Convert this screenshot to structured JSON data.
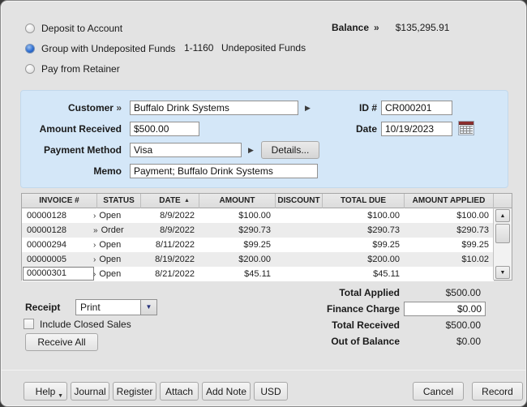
{
  "colors": {
    "panel_blue": "#d4e7f8",
    "window_background": "#e3e3e3",
    "radio_selected_blue": "#2f6fd2",
    "combo_arrow_blue": "#24307a",
    "calendar_icon_red": "#8c2f2f"
  },
  "icons": {
    "picker_arrow": "▶",
    "sort_ascending": "▲",
    "scroll_up": "▲",
    "scroll_down": "▼",
    "combo_arrow": "▼",
    "help_menu_arrow": "▼"
  },
  "deposit_options": {
    "radios": [
      {
        "label": "Deposit to Account",
        "selected": false
      },
      {
        "label": "Group with Undeposited Funds",
        "selected": true
      },
      {
        "label": "Pay from Retainer",
        "selected": false
      }
    ],
    "account_number": "1-1160",
    "account_name": "Undeposited Funds"
  },
  "balance": {
    "label": "Balance",
    "chevron": "»",
    "value": "$135,295.91"
  },
  "payment_form": {
    "customer_label": "Customer",
    "customer_chevron": "»",
    "customer_value": "Buffalo Drink Systems",
    "id_label": "ID #",
    "id_value": "CR000201",
    "amount_received_label": "Amount Received",
    "amount_received_value": "$500.00",
    "date_label": "Date",
    "date_value": "10/19/2023",
    "payment_method_label": "Payment Method",
    "payment_method_value": "Visa",
    "details_button": "Details...",
    "memo_label": "Memo",
    "memo_value": "Payment; Buffalo Drink Systems"
  },
  "invoice_table": {
    "columns": [
      "INVOICE #",
      "STATUS",
      "DATE",
      "AMOUNT",
      "DISCOUNT",
      "TOTAL DUE",
      "AMOUNT APPLIED"
    ],
    "sort_column": "DATE",
    "sort_direction": "ascending",
    "rows": [
      {
        "invoice": "00000128",
        "arrow": "›",
        "status": "Open",
        "date": "8/9/2022",
        "amount": "$100.00",
        "discount": "",
        "total_due": "$100.00",
        "amount_applied": "$100.00"
      },
      {
        "invoice": "00000128",
        "arrow": "»",
        "status": "Order",
        "date": "8/9/2022",
        "amount": "$290.73",
        "discount": "",
        "total_due": "$290.73",
        "amount_applied": "$290.73"
      },
      {
        "invoice": "00000294",
        "arrow": "›",
        "status": "Open",
        "date": "8/11/2022",
        "amount": "$99.25",
        "discount": "",
        "total_due": "$99.25",
        "amount_applied": "$99.25"
      },
      {
        "invoice": "00000005",
        "arrow": "›",
        "status": "Open",
        "date": "8/19/2022",
        "amount": "$200.00",
        "discount": "",
        "total_due": "$200.00",
        "amount_applied": "$10.02"
      },
      {
        "invoice": "00000301",
        "arrow": "›",
        "status": "Open",
        "date": "8/21/2022",
        "amount": "$45.11",
        "discount": "",
        "total_due": "$45.11",
        "amount_applied": ""
      }
    ]
  },
  "totals": {
    "total_applied": {
      "label": "Total Applied",
      "value": "$500.00"
    },
    "finance_charge": {
      "label": "Finance Charge",
      "value": "$0.00"
    },
    "total_received": {
      "label": "Total Received",
      "value": "$500.00"
    },
    "out_of_balance": {
      "label": "Out of Balance",
      "value": "$0.00"
    }
  },
  "receipt": {
    "label": "Receipt",
    "selected_option": "Print"
  },
  "include_closed_sales": {
    "label": "Include Closed Sales",
    "checked": false
  },
  "receive_all_button": "Receive All",
  "footer": {
    "buttons": [
      "Help",
      "Journal",
      "Register",
      "Attach",
      "Add Note",
      "USD"
    ],
    "cancel_button": "Cancel",
    "record_button": "Record"
  }
}
